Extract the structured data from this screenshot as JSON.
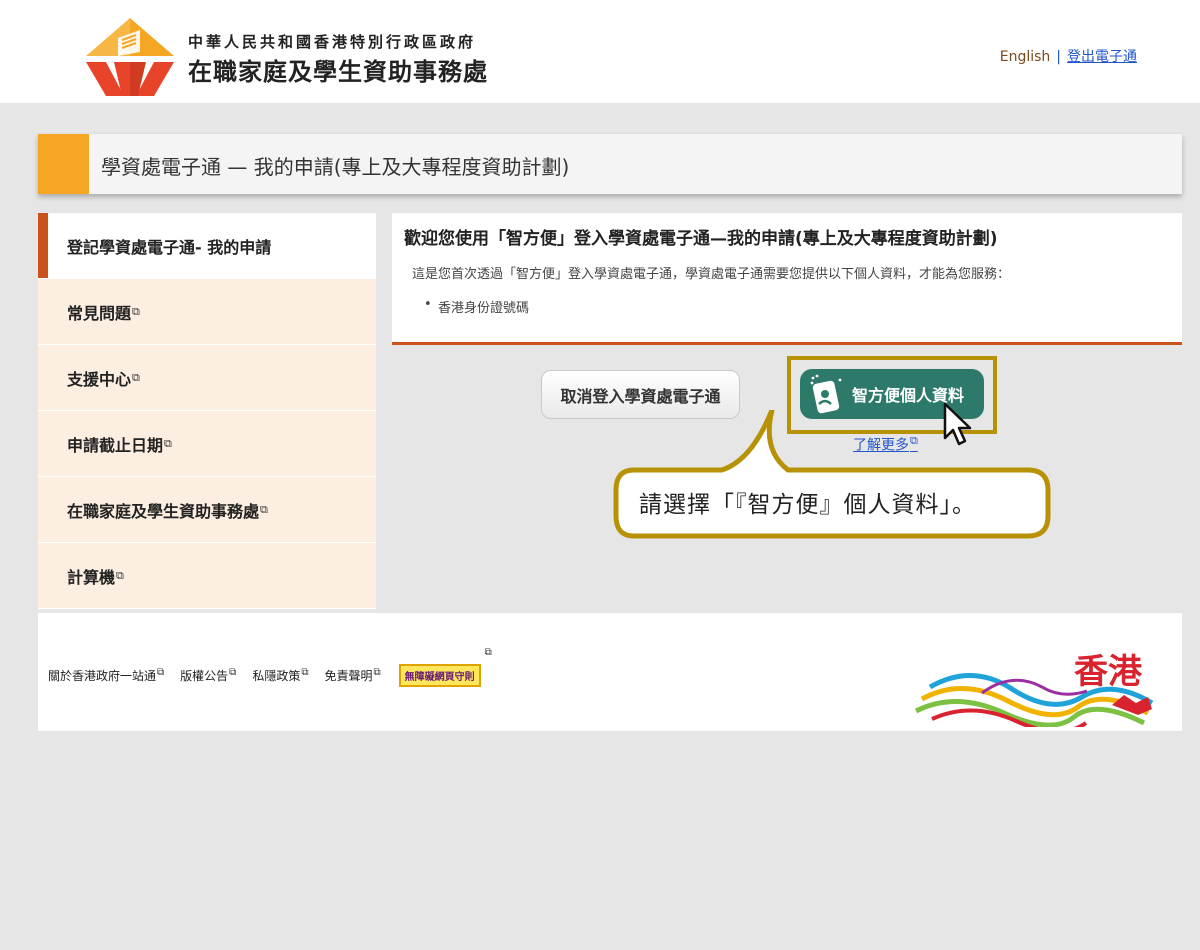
{
  "header": {
    "dept_cn": "中華人民共和國香港特別行政區政府",
    "dept_name": "在職家庭及學生資助事務處",
    "lang_link": "English",
    "separator": "|",
    "logout_link": "登出電子通"
  },
  "title_bar": {
    "title": "學資處電子通 — 我的申請(專上及大專程度資助計劃)"
  },
  "sidebar": {
    "items": [
      {
        "label": "登記學資處電子通- 我的申請",
        "external": false,
        "active": true
      },
      {
        "label": "常見問題",
        "external": true
      },
      {
        "label": "支援中心",
        "external": true
      },
      {
        "label": "申請截止日期",
        "external": true
      },
      {
        "label": "在職家庭及學生資助事務處",
        "external": true
      },
      {
        "label": "計算機",
        "external": true
      }
    ]
  },
  "welcome": {
    "title": "歡迎您使用「智方便」登入學資處電子通—我的申請(專上及大專程度資助計劃)",
    "description": "這是您首次透過「智方便」登入學資處電子通，學資處電子通需要您提供以下個人資料，才能為您服務：",
    "items": [
      "香港身份證號碼"
    ]
  },
  "actions": {
    "cancel_label": "取消登入學資處電子通",
    "iam_label": "智方便個人資料",
    "learn_more": "了解更多"
  },
  "callout": {
    "text": "請選擇「『智方便』個人資料」。"
  },
  "footer": {
    "links": [
      "關於香港政府一站通",
      "版權公告",
      "私隱政策",
      "免責聲明"
    ],
    "accessibility_badge": "無障礙網頁守則",
    "brand": "香港"
  },
  "colors": {
    "accent_orange": "#f5a623",
    "sidebar_active_bar": "#c9531b",
    "iam_green": "#2e7a6a",
    "callout_gold": "#b79106",
    "link_blue": "#2255cc"
  },
  "icons": {
    "external": "external-link-icon",
    "iam_phone": "iam-smart-icon",
    "cursor": "mouse-pointer-icon"
  }
}
